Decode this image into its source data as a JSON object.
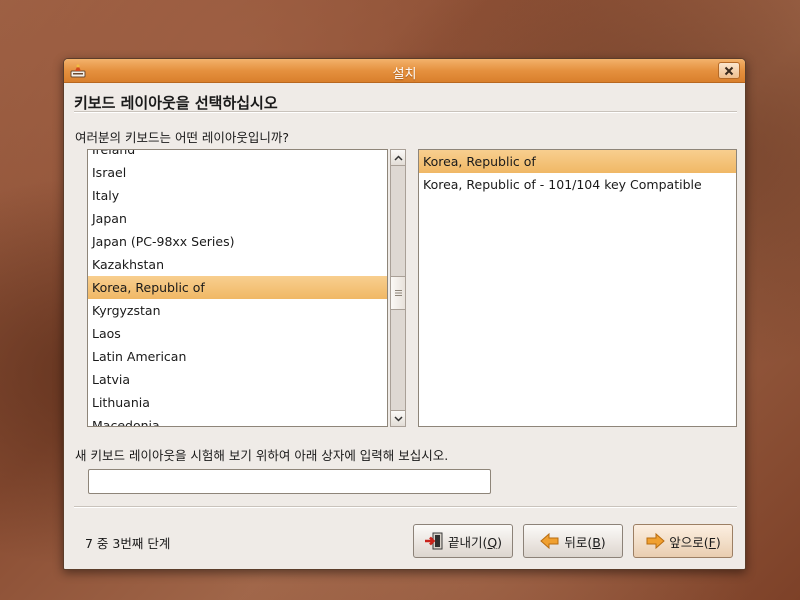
{
  "window": {
    "title": "설치"
  },
  "header": {
    "title": "키보드 레이아웃을 선택하십시오"
  },
  "question": "여러분의 키보드는 어떤 레이아웃입니까?",
  "countries": {
    "items": [
      "Ireland",
      "Israel",
      "Italy",
      "Japan",
      "Japan (PC-98xx Series)",
      "Kazakhstan",
      "Korea, Republic of",
      "Kyrgyzstan",
      "Laos",
      "Latin American",
      "Latvia",
      "Lithuania",
      "Macedonia"
    ],
    "selected": "Korea, Republic of"
  },
  "variants": {
    "items": [
      "Korea, Republic of",
      "Korea, Republic of - 101/104 key Compatible"
    ],
    "selected": "Korea, Republic of"
  },
  "test": {
    "label": "새 키보드 레이아웃을 시험해 보기 위하여 아래 상자에 입력해 보십시오.",
    "value": ""
  },
  "footer": {
    "step": "7 중 3번째 단계",
    "quit": {
      "label": "끝내기(",
      "key": "Q",
      "suffix": ")"
    },
    "back": {
      "label": "뒤로(",
      "key": "B",
      "suffix": ")"
    },
    "forward": {
      "label": "앞으로(",
      "key": "F",
      "suffix": ")"
    }
  },
  "colors": {
    "accent": "#e5913f",
    "selection": "#f3c37a"
  }
}
